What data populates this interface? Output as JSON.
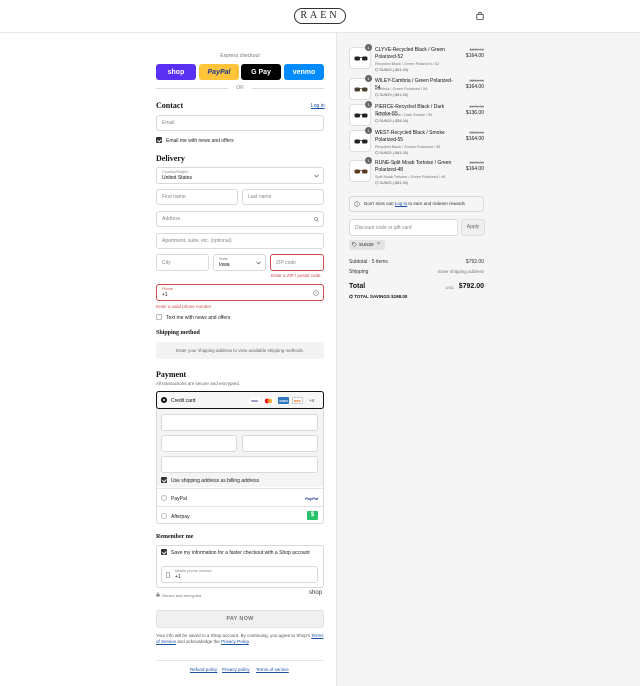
{
  "header": {
    "logo": "RAEN",
    "cart_icon": "shopping-bag-icon"
  },
  "express": {
    "title": "Express checkout",
    "buttons": [
      {
        "label": "shop",
        "color": "#5a31f4"
      },
      {
        "label": "PayPal",
        "color": "#ffc439"
      },
      {
        "label": "G Pay",
        "color": "#000000"
      },
      {
        "label": "venmo",
        "color": "#008cff"
      }
    ],
    "or": "OR"
  },
  "contact": {
    "title": "Contact",
    "login": "Log in",
    "email_placeholder": "Email",
    "news_label": "Email me with news and offers"
  },
  "delivery": {
    "title": "Delivery",
    "country_label": "Country/Region",
    "country_value": "United States",
    "first_name": "First name",
    "last_name": "Last name",
    "address": "Address",
    "apartment": "Apartment, suite, etc. (optional)",
    "city": "City",
    "state_label": "State",
    "state_value": "Iowa",
    "zip": "ZIP code",
    "zip_error": "Enter a ZIP / postal code",
    "phone_label": "Phone",
    "phone_value": "+1",
    "phone_error": "Enter a valid phone number",
    "text_label": "Text me with news and offers"
  },
  "shipping": {
    "title": "Shipping method",
    "placeholder": "Enter your shipping address to view available shipping methods."
  },
  "payment": {
    "title": "Payment",
    "subtitle": "All transactions are secure and encrypted.",
    "credit_card": "Credit card",
    "card_more": "+4",
    "billing_label": "Use shipping address as billing address",
    "paypal": "PayPal",
    "paypal_logo": "PayPal",
    "afterpay": "Afterpay",
    "afterpay_logo": "$"
  },
  "remember": {
    "title": "Remember me",
    "save_label": "Save my information for a faster checkout with a Shop account",
    "mobile_label": "Mobile phone number",
    "mobile_value": "+1",
    "secure": "Secure and encrypted",
    "shop_logo": "shop"
  },
  "pay_now": "PAY NOW",
  "legal": {
    "text1": "Your info will be saved to a Shop account. By continuing, you agree to Shop's",
    "terms": "Terms of Service",
    "and": "and acknowledge the",
    "privacy": "Privacy Policy",
    "period": "."
  },
  "footer": {
    "refund": "Refund policy",
    "privacy": "Privacy policy",
    "terms": "Terms of service"
  },
  "products": [
    {
      "qty": "1",
      "name": "CLYVE-Recycled Black / Green Polarized-52",
      "variant": "Recycled Black / Green Polarized / 52",
      "discount": "SUN20 (-$41.00)",
      "old_price": "$205.00",
      "price": "$164.00"
    },
    {
      "qty": "1",
      "name": "WILEY-Cambria / Green Polarized-54",
      "variant": "Cambria / Green Polarized / 54",
      "discount": "SUN20 (-$41.00)",
      "old_price": "$205.00",
      "price": "$164.00"
    },
    {
      "qty": "1",
      "name": "PIERCE-Recycled Black / Dark Smoke-55",
      "variant": "Recycled Black / Dark Smoke / 55",
      "discount": "SUN20 (-$34.00)",
      "old_price": "$170.00",
      "price": "$136.00"
    },
    {
      "qty": "1",
      "name": "WEST-Recycled Black / Smoke Polarized-55",
      "variant": "Recycled Black / Smoke Polarized / 55",
      "discount": "SUN20 (-$41.00)",
      "old_price": "$205.00",
      "price": "$164.00"
    },
    {
      "qty": "1",
      "name": "RUNE-Split Moab Tortoise / Green Polarized-48",
      "variant": "Split Moab Tortoise / Green Polarized / 48",
      "discount": "SUN20 (-$41.00)",
      "old_price": "$205.00",
      "price": "$164.00"
    }
  ],
  "rewards": {
    "prefix": "Don't miss out!",
    "link": "Log in",
    "suffix": "to earn and redeem rewards"
  },
  "discount": {
    "placeholder": "Discount code or gift card",
    "apply": "Apply",
    "tag": "SUN20"
  },
  "summary": {
    "subtotal_label": "Subtotal · 5 items",
    "subtotal_value": "$792.00",
    "shipping_label": "Shipping",
    "shipping_value": "Enter shipping address",
    "total_label": "Total",
    "currency": "USD",
    "total_value": "$792.00",
    "savings_label": "TOTAL SAVINGS",
    "savings_value": "$198.00"
  }
}
